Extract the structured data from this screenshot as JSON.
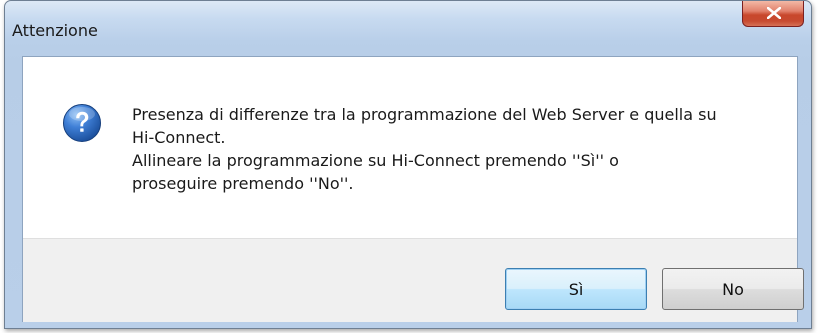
{
  "window": {
    "title": "Attenzione"
  },
  "message": {
    "lines": [
      "Presenza di differenze tra la programmazione del Web Server e quella su",
      "Hi-Connect.",
      "Allineare la programmazione su Hi-Connect premendo ''Sì'' o",
      "proseguire premendo ''No''."
    ],
    "icon": "question-icon"
  },
  "buttons": {
    "yes_label": "Sì",
    "no_label": "No"
  },
  "colors": {
    "frame": "#b9cfe9",
    "close_button": "#c8472c",
    "icon": "#2a63b8",
    "footer": "#f0f0f0"
  }
}
